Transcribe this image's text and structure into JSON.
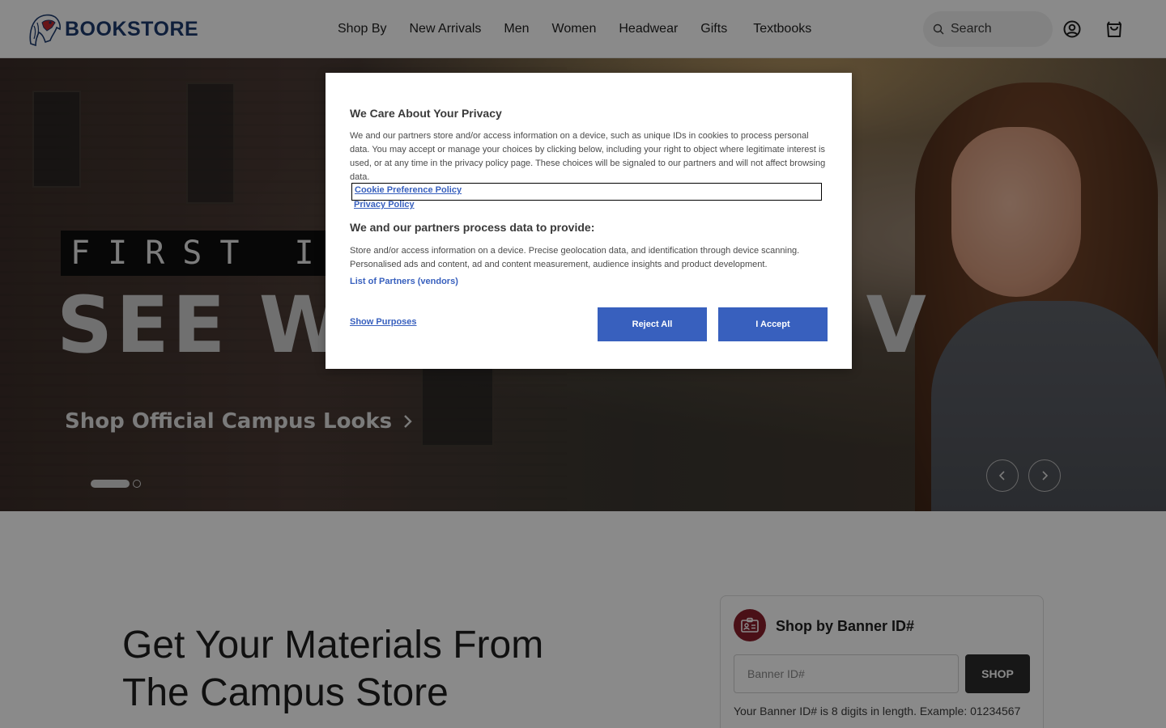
{
  "header": {
    "logo_text": "BOOKSTORE",
    "logo_icon": "mascot-logo-icon",
    "nav": [
      "Shop By",
      "New Arrivals",
      "Men",
      "Women",
      "Headwear",
      "Gifts",
      "Textbooks"
    ],
    "search": {
      "placeholder": "Search",
      "icon": "search-icon"
    },
    "account_icon": "account-icon",
    "cart_icon": "cart-icon"
  },
  "hero": {
    "tagline": "FIRST IN",
    "headline": "SEE W",
    "headline_end": "V",
    "link": "Shop Official Campus Looks",
    "link_icon": "chevron-right-icon",
    "slides_total": 2,
    "active_slide": 1,
    "prev_icon": "chevron-left-icon",
    "next_icon": "chevron-right-icon"
  },
  "main": {
    "headline": "Get Your Materials From The Campus Store"
  },
  "banner_card": {
    "icon": "id-card-icon",
    "title": "Shop by Banner ID#",
    "input_placeholder": "Banner ID#",
    "button_label": "SHOP",
    "hint": "Your Banner ID# is 8 digits in length. Example: 01234567"
  },
  "privacy_modal": {
    "title": "We Care About Your Privacy",
    "body": "We and our partners store and/or access information on a device, such as unique IDs in cookies to process personal data. You may accept or manage your choices by clicking below, including your right to object where legitimate interest is used, or at any time in the privacy policy page. These choices will be signaled to our partners and will not affect browsing data.",
    "cookie_policy_link": "Cookie Preference Policy",
    "privacy_policy_link": "Privacy Policy",
    "subtitle": "We and our partners process data to provide:",
    "body2": "Store and/or access information on a device. Precise geolocation data, and identification through device scanning. Personalised ads and content, ad and content measurement, audience insights and product development.",
    "partners_link": "List of Partners (vendors)",
    "show_purposes": "Show Purposes",
    "reject_label": "Reject All",
    "accept_label": "I Accept",
    "button_color": "#3860be"
  }
}
